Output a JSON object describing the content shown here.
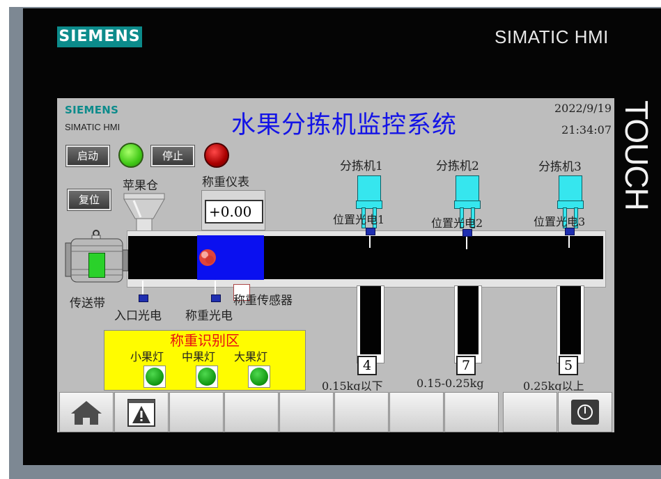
{
  "device": {
    "brand": "SIEMENS",
    "model": "SIMATIC HMI",
    "side_label": "TOUCH"
  },
  "screen": {
    "logo_brand": "SIEMENS",
    "logo_model": "SIMATIC HMI",
    "title": "水果分拣机监控系统",
    "date": "2022/9/19",
    "time": "21:34:07"
  },
  "controls": {
    "start_label": "启动",
    "stop_label": "停止",
    "reset_label": "复位",
    "running": true,
    "stopped_alarm": true
  },
  "labels": {
    "apple_bin": "苹果仓",
    "scale": "称重仪表",
    "conveyor": "传送带",
    "entry_sensor": "入口光电",
    "weigh_sensor": "称重光电",
    "load_cell": "称重传感器"
  },
  "scale": {
    "value": "+0.00"
  },
  "sorters": [
    {
      "name": "分拣机1",
      "sensor": "位置光电1",
      "count": "4",
      "range": "0.15kg以下"
    },
    {
      "name": "分拣机2",
      "sensor": "位置光电2",
      "count": "7",
      "range": "0.15-0.25kg"
    },
    {
      "name": "分拣机3",
      "sensor": "位置光电3",
      "count": "5",
      "range": "0.25kg以上"
    }
  ],
  "weigh_zone": {
    "title": "称重识别区",
    "small_label": "小果灯",
    "medium_label": "中果灯",
    "large_label": "大果灯"
  },
  "nav": {
    "keys": [
      "home-icon",
      "alarm-icon",
      "",
      "",
      "",
      "",
      "",
      "",
      "",
      "power-icon"
    ]
  },
  "colors": {
    "title_blue": "#1414e6",
    "brand_teal": "#0c8b8b",
    "belt": "#020202",
    "weigh_zone": "#0a10f0",
    "panel_yellow": "#fffc00",
    "sorter_cyan": "#36e6ee"
  }
}
